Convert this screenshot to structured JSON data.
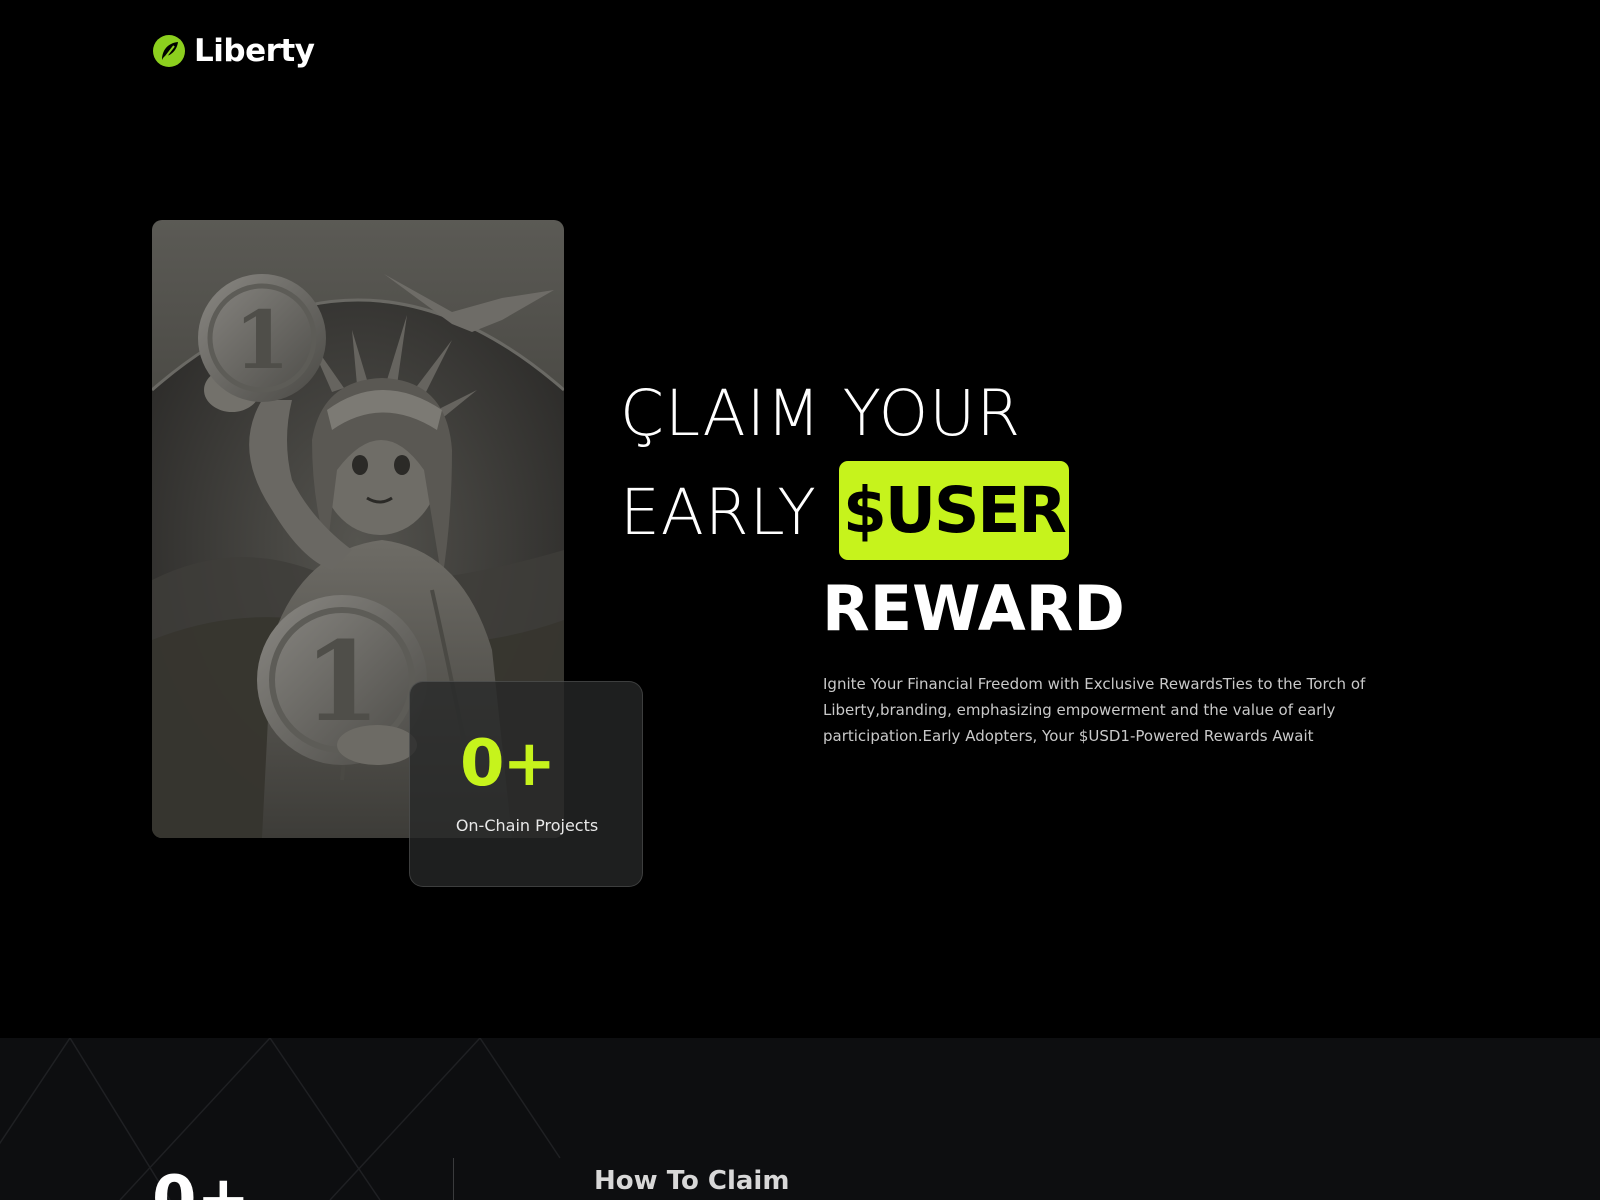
{
  "header": {
    "brand_name": "Liberty",
    "logo_icon": "liberty-leaf-logo-icon"
  },
  "hero": {
    "headline_line_1": "ÇLAIM YOUR",
    "headline_line_2": "EARLY",
    "highlight": "$USER",
    "headline_line_3": "REWARD",
    "description": "Ignite Your Financial Freedom with Exclusive RewardsTies to the Torch of Liberty,branding, emphasizing empowerment and the value of early participation.Early Adopters, Your $USD1-Powered Rewards Await",
    "illustration": "statue-of-liberty-coins-illustration",
    "stat": {
      "value": "0+",
      "label": "On-Chain Projects"
    }
  },
  "how_to_claim": {
    "counter": "0+",
    "title": "How To Claim"
  },
  "colors": {
    "accent": "#c6f31c",
    "background": "#000000",
    "section_background": "#0d0e10"
  }
}
